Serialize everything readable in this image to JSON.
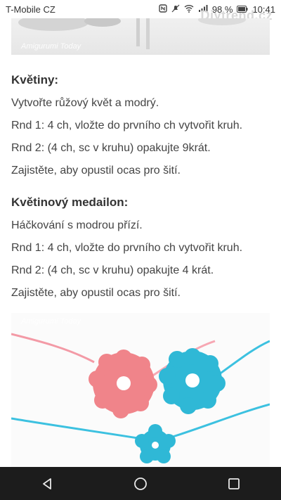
{
  "status_bar": {
    "carrier": "T-Mobile CZ",
    "battery": "98 %",
    "time": "10:41"
  },
  "watermark": "Diytrend.cz",
  "article": {
    "photo_top_caption": "Amigurumi Today",
    "section1": {
      "heading": "Květiny:",
      "lines": [
        "Vytvořte růžový květ a modrý.",
        "Rnd 1: 4 ch, vložte do prvního ch vytvořit kruh.",
        "Rnd 2: (4 ch, sc v kruhu) opakujte 9krát.",
        "Zajistěte, aby opustil ocas pro šití."
      ]
    },
    "section2": {
      "heading": "Květinový medailon:",
      "lines": [
        "Háčkování s modrou přízí.",
        "Rnd 1: 4 ch, vložte do prvního ch vytvořit kruh.",
        "Rnd 2: (4 ch, sc v kruhu) opakujte 4 krát.",
        "Zajistěte, aby opustil ocas pro šití."
      ]
    },
    "photo_flowers_caption": "Amigurumi Today"
  },
  "icons": {
    "nfc": "nfc-icon",
    "silent": "silent-icon",
    "wifi": "wifi-icon",
    "signal": "signal-icon",
    "battery": "battery-icon",
    "back": "back-icon",
    "home": "home-icon",
    "recents": "recents-icon"
  },
  "colors": {
    "pink_flower": "#f0848a",
    "blue_flower": "#2fb8d6",
    "navbar": "#1c1c1c"
  }
}
